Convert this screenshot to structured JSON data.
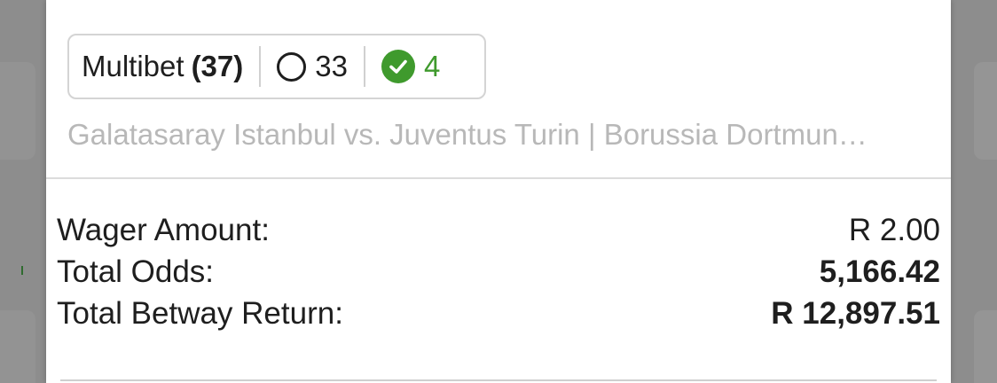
{
  "multibet": {
    "label": "Multibet",
    "count": "(37)",
    "open_count": "33",
    "won_count": "4",
    "won_color": "#3f9a2d",
    "open_icon": "circle-outline-icon",
    "won_icon": "check-circle-icon"
  },
  "events_summary": "Galatasaray Istanbul vs. Juventus Turin | Borussia Dortmun…",
  "summary": {
    "wager_label": "Wager Amount:",
    "wager_value": "R 2.00",
    "odds_label": "Total Odds:",
    "odds_value": "5,166.42",
    "return_label": "Total Betway Return:",
    "return_value": "R 12,897.51"
  }
}
